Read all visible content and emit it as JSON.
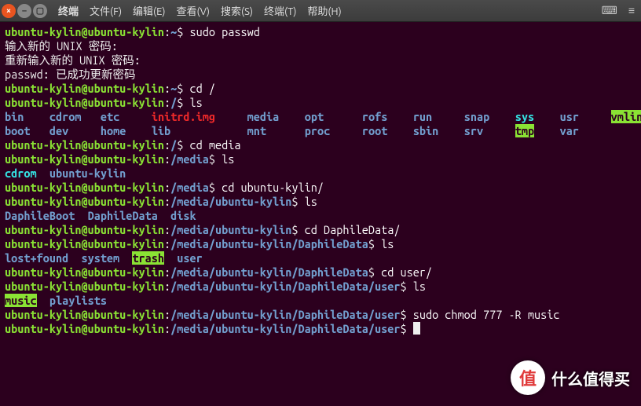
{
  "window": {
    "title": "终端"
  },
  "menu": [
    "终端",
    "文件(F)",
    "编辑(E)",
    "查看(V)",
    "搜索(S)",
    "终端(T)",
    "帮助(H)"
  ],
  "colors": {
    "user": "#8ae234",
    "path": "#729fcf",
    "dir": "#729fcf",
    "file_red": "#ef2929",
    "hl_bg": "#8ae234",
    "cyan": "#34e2e2",
    "bg": "#2c001e",
    "fg": "#eee"
  },
  "prompt": {
    "user": "ubuntu-kylin@ubuntu-kylin",
    "sep": ":",
    "end": "$ "
  },
  "lines": [
    {
      "path": "~",
      "cmd": "sudo passwd"
    },
    {
      "plain": "输入新的 UNIX 密码:"
    },
    {
      "plain": "重新输入新的 UNIX 密码:"
    },
    {
      "plain": "passwd: 已成功更新密码"
    },
    {
      "path": "~",
      "cmd": "cd /"
    },
    {
      "path": "/",
      "cmd": "ls"
    },
    {
      "dir_row1": [
        {
          "t": "bin",
          "c": "dir"
        },
        {
          "t": "cdrom",
          "c": "dir"
        },
        {
          "t": "etc",
          "c": "dir"
        },
        {
          "t": "initrd.img",
          "c": "file-red"
        },
        {
          "t": "media",
          "c": "dir"
        },
        {
          "t": "opt",
          "c": "dir"
        },
        {
          "t": "rofs",
          "c": "dir"
        },
        {
          "t": "run",
          "c": "dir"
        },
        {
          "t": "snap",
          "c": "dir"
        },
        {
          "t": "sys",
          "c": "cyan"
        },
        {
          "t": "usr",
          "c": "dir"
        },
        {
          "t": "vmlinuz",
          "c": "hlgreen"
        }
      ],
      "cols": [
        0,
        7,
        15,
        23,
        38,
        47,
        56,
        64,
        72,
        80,
        87,
        95
      ]
    },
    {
      "dir_row2": [
        {
          "t": "boot",
          "c": "dir"
        },
        {
          "t": "dev",
          "c": "dir"
        },
        {
          "t": "home",
          "c": "dir"
        },
        {
          "t": "lib",
          "c": "dir"
        },
        {
          "t": "mnt",
          "c": "dir"
        },
        {
          "t": "proc",
          "c": "dir"
        },
        {
          "t": "root",
          "c": "dir"
        },
        {
          "t": "sbin",
          "c": "dir"
        },
        {
          "t": "srv",
          "c": "dir"
        },
        {
          "t": "tmp",
          "c": "hlgreen"
        },
        {
          "t": "var",
          "c": "dir"
        }
      ],
      "cols": [
        0,
        7,
        15,
        23,
        38,
        47,
        56,
        64,
        72,
        80,
        87
      ]
    },
    {
      "path": "/",
      "cmd": "cd media"
    },
    {
      "path": "/media",
      "cmd": "ls"
    },
    {
      "list": [
        {
          "t": "cdrom",
          "c": "cyan"
        },
        {
          "t": "ubuntu-kylin",
          "c": "dir"
        }
      ],
      "gap": "  "
    },
    {
      "path": "/media",
      "cmd": "cd ubuntu-kylin/"
    },
    {
      "path": "/media/ubuntu-kylin",
      "cmd": "ls"
    },
    {
      "list": [
        {
          "t": "DaphileBoot",
          "c": "dir"
        },
        {
          "t": "DaphileData",
          "c": "dir"
        },
        {
          "t": "disk",
          "c": "dir"
        }
      ],
      "gap": "  "
    },
    {
      "path": "/media/ubuntu-kylin",
      "cmd": "cd DaphileData/"
    },
    {
      "path": "/media/ubuntu-kylin/DaphileData",
      "cmd": "ls"
    },
    {
      "list": [
        {
          "t": "lost+found",
          "c": "dir"
        },
        {
          "t": "system",
          "c": "dir"
        },
        {
          "t": "trash",
          "c": "hlgreen"
        },
        {
          "t": "user",
          "c": "dir"
        }
      ],
      "gap": "  "
    },
    {
      "path": "/media/ubuntu-kylin/DaphileData",
      "cmd": "cd user/"
    },
    {
      "path": "/media/ubuntu-kylin/DaphileData/user",
      "cmd": "ls"
    },
    {
      "list": [
        {
          "t": "music",
          "c": "hlgreen"
        },
        {
          "t": "playlists",
          "c": "dir"
        }
      ],
      "gap": "  "
    },
    {
      "path": "/media/ubuntu-kylin/DaphileData/user",
      "cmd": "sudo chmod 777 -R music"
    },
    {
      "path": "/media/ubuntu-kylin/DaphileData/user",
      "cmd": "",
      "cursor": true
    }
  ],
  "watermark": {
    "badge": "值",
    "text": "什么值得买"
  }
}
